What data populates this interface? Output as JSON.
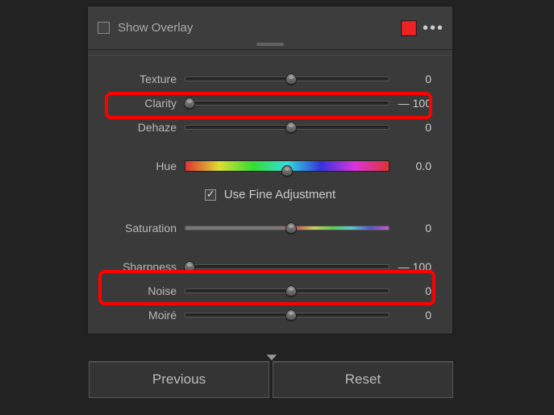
{
  "header": {
    "show_overlay_label": "Show Overlay",
    "swatch_color": "#e22222"
  },
  "sliders": {
    "texture": {
      "label": "Texture",
      "value": "0",
      "pos": 52
    },
    "clarity": {
      "label": "Clarity",
      "value": "— 100",
      "pos": 2
    },
    "dehaze": {
      "label": "Dehaze",
      "value": "0",
      "pos": 52
    },
    "hue": {
      "label": "Hue",
      "value": "0.0",
      "pos": 50
    },
    "saturation": {
      "label": "Saturation",
      "value": "0",
      "pos": 52
    },
    "sharpness": {
      "label": "Sharpness",
      "value": "— 100",
      "pos": 2
    },
    "noise": {
      "label": "Noise",
      "value": "0",
      "pos": 52
    },
    "moire": {
      "label": "Moiré",
      "value": "0",
      "pos": 52
    }
  },
  "fine_adjust_label": "Use Fine Adjustment",
  "buttons": {
    "previous": "Previous",
    "reset": "Reset"
  }
}
